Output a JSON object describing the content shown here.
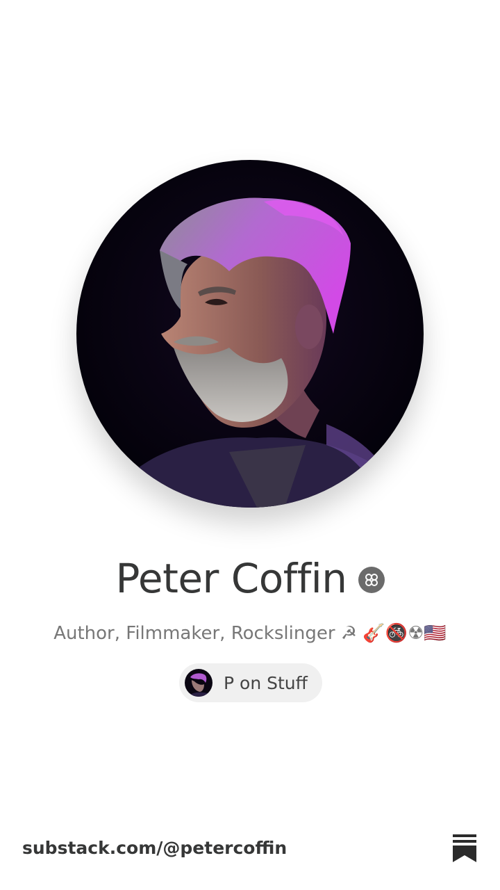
{
  "profile": {
    "name": "Peter Coffin",
    "bio": "Author, Filmmaker, Rockslinger ☭ 🎸🚳☢🇺🇸",
    "badge_icon": "substack-founding-badge-icon"
  },
  "publication": {
    "name": "P on Stuff",
    "logo_icon": "publication-avatar"
  },
  "footer": {
    "url": "substack.com/@petercoffin",
    "logo_icon": "substack-logo-icon"
  },
  "colors": {
    "background": "#ffffff",
    "name_text": "#363737",
    "bio_text": "#777777",
    "pill_background": "#f0f0f0",
    "badge": "#6b6b6b",
    "hair_accent": "#c04ad8"
  }
}
